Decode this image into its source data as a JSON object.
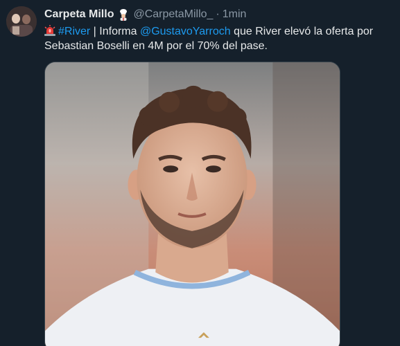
{
  "tweet": {
    "display_name": "Carpeta Millo",
    "handle": "@CarpetaMillo_",
    "separator": "·",
    "time": "1min",
    "text_parts": {
      "hashtag": "#River",
      "divider": " | Informa ",
      "mention": "@GustavoYarroch",
      "rest": " que River elevó la oferta por Sebastian Boselli en 4M por el 70% del pase."
    },
    "icons": {
      "name_emoji": "chef-emoji-icon",
      "siren": "siren-icon"
    },
    "media": {
      "alt": "player-photo"
    }
  },
  "colors": {
    "background": "#15202b",
    "link": "#1d9bf0",
    "secondary": "#8b98a5",
    "text": "#e7e9ea"
  }
}
